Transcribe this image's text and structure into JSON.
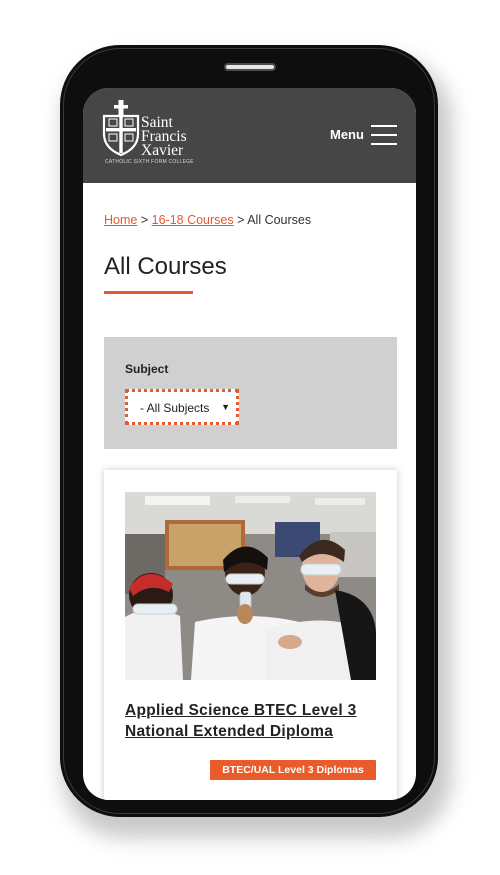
{
  "brand": {
    "name": "Saint\nFrancis\nXavier",
    "tagline": "CATHOLIC SIXTH FORM COLLEGE"
  },
  "header": {
    "menu_label": "Menu"
  },
  "breadcrumb": {
    "items": [
      "Home",
      "16-18 Courses",
      "All Courses"
    ],
    "separator": ">"
  },
  "page": {
    "title": "All Courses"
  },
  "filter": {
    "subject_label": "Subject",
    "subject_selected": "- All Subjects",
    "caret": "▼"
  },
  "courses": [
    {
      "title": "Applied Science BTEC Level 3 National Extended Diploma",
      "badge": "BTEC/UAL Level 3 Diplomas"
    }
  ],
  "colors": {
    "accent": "#e55a2b",
    "header_bg": "#464646",
    "filter_bg": "#d0d0d0"
  }
}
